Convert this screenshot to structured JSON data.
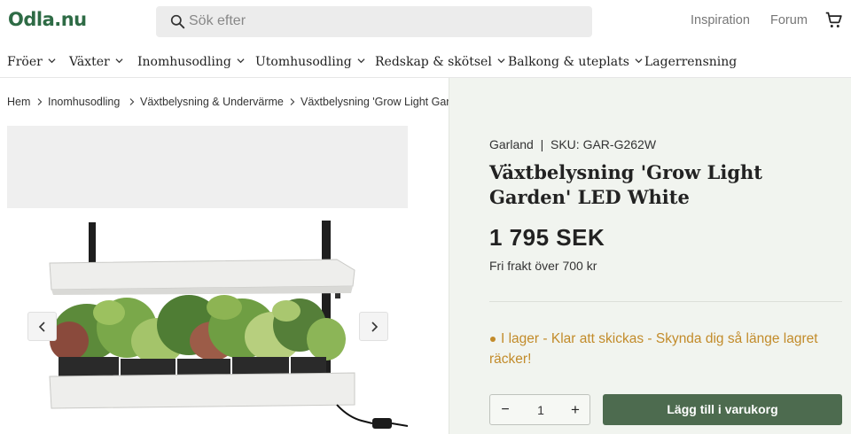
{
  "header": {
    "logo": "Odla.nu",
    "search_placeholder": "Sök efter",
    "links": [
      "Inspiration",
      "Forum"
    ]
  },
  "nav": {
    "items": [
      "Fröer",
      "Växter",
      "Inomhusodling",
      "Utomhusodling",
      "Redskap & skötsel",
      "Balkong & uteplats",
      "Lagerrensning"
    ]
  },
  "breadcrumb": [
    "Hem",
    "Inomhusodling",
    "Växtbelysning & Undervärme",
    "Växtbelysning 'Grow Light Garden' LED White"
  ],
  "product": {
    "brand_line": "Garland  |  SKU: GAR-G262W",
    "title": "Växtbelysning 'Grow Light Garden' LED White",
    "price": "1 795 SEK",
    "shipping": "Fri frakt över 700 kr",
    "stock": "I lager - Klar att skickas - Skynda dig så länge lagret räcker!",
    "quantity": "1",
    "qty_minus": "−",
    "qty_plus": "+",
    "add_to_cart": "Lägg till i varukorg"
  },
  "colors": {
    "brand": "#2e6b45",
    "button": "#4d6b4f",
    "stock": "#c28b2a",
    "panel_bg": "#f1f4ef"
  },
  "icons": [
    "search-icon",
    "cart-icon",
    "chevron-down-icon",
    "chevron-right-icon",
    "chevron-left-icon"
  ]
}
